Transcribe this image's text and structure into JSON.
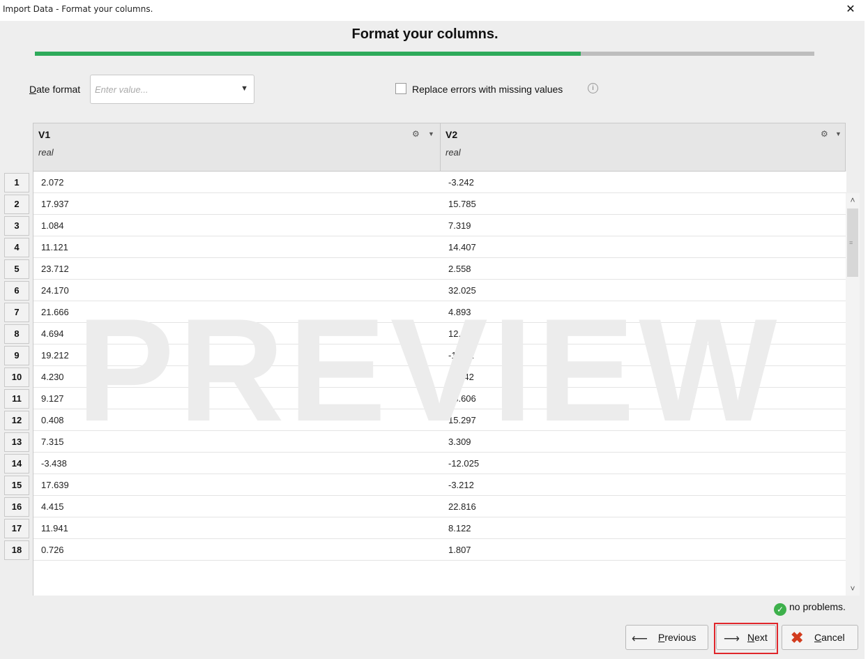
{
  "window": {
    "title": "Import Data - Format your columns.",
    "close_glyph": "✕"
  },
  "wizard": {
    "heading": "Format your columns.",
    "progress_fraction": 0.7
  },
  "options": {
    "date_format_label": "Date format",
    "date_format_placeholder": "Enter value...",
    "dropdown_arrow": "▼",
    "replace_errors_label": "Replace errors with missing values",
    "info_glyph": "i"
  },
  "columns": [
    {
      "name": "V1",
      "type": "real"
    },
    {
      "name": "V2",
      "type": "real"
    }
  ],
  "rows": [
    {
      "num": "1",
      "v1": "2.072",
      "v2": "-3.242"
    },
    {
      "num": "2",
      "v1": "17.937",
      "v2": "15.785"
    },
    {
      "num": "3",
      "v1": "1.084",
      "v2": "7.319"
    },
    {
      "num": "4",
      "v1": "11.121",
      "v2": "14.407"
    },
    {
      "num": "5",
      "v1": "23.712",
      "v2": "2.558"
    },
    {
      "num": "6",
      "v1": "24.170",
      "v2": "32.025"
    },
    {
      "num": "7",
      "v1": "21.666",
      "v2": "4.893"
    },
    {
      "num": "8",
      "v1": "4.694",
      "v2": "12.342"
    },
    {
      "num": "9",
      "v1": "19.212",
      "v2": "-1.121"
    },
    {
      "num": "10",
      "v1": "4.230",
      "v2": "-4.442"
    },
    {
      "num": "11",
      "v1": "9.127",
      "v2": "23.606"
    },
    {
      "num": "12",
      "v1": "0.408",
      "v2": "15.297"
    },
    {
      "num": "13",
      "v1": "7.315",
      "v2": "3.309"
    },
    {
      "num": "14",
      "v1": "-3.438",
      "v2": "-12.025"
    },
    {
      "num": "15",
      "v1": "17.639",
      "v2": "-3.212"
    },
    {
      "num": "16",
      "v1": "4.415",
      "v2": "22.816"
    },
    {
      "num": "17",
      "v1": "11.941",
      "v2": "8.122"
    },
    {
      "num": "18",
      "v1": "0.726",
      "v2": "1.807"
    }
  ],
  "watermark": "PREVIEW",
  "status": {
    "text": "no problems.",
    "icon": "check-icon"
  },
  "buttons": {
    "previous_label": "Previous",
    "next_label": "Next",
    "cancel_label": "Cancel"
  },
  "colors": {
    "progress": "#2eaa5a",
    "highlight": "#e0262b",
    "cancel_x": "#d23c1e",
    "ok": "#3db04b"
  }
}
